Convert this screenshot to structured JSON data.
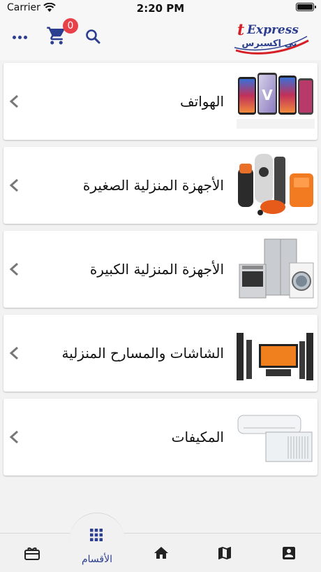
{
  "status_bar": {
    "carrier": "Carrier",
    "time": "2:20 PM"
  },
  "header": {
    "cart_count": "0",
    "logo_latin": "Express",
    "logo_arabic": "تي اكسبرس",
    "logo_prefix": "t"
  },
  "categories": [
    {
      "label": "الهواتف",
      "image": "phones"
    },
    {
      "label": "الأجهزة المنزلية الصغيرة",
      "image": "small-appliances"
    },
    {
      "label": "الأجهزة المنزلية الكبيرة",
      "image": "large-appliances"
    },
    {
      "label": "الشاشات والمسارح المنزلية",
      "image": "tv-home-theater"
    },
    {
      "label": "المكيفات",
      "image": "air-conditioners"
    }
  ],
  "bottom_nav": {
    "active_label": "الأقسام",
    "items": [
      "gift-card-icon",
      "grid-icon",
      "home-icon",
      "map-icon",
      "account-icon"
    ]
  },
  "colors": {
    "accent": "#2c3e8f",
    "badge": "#e8414a",
    "logo_red": "#d62027"
  }
}
